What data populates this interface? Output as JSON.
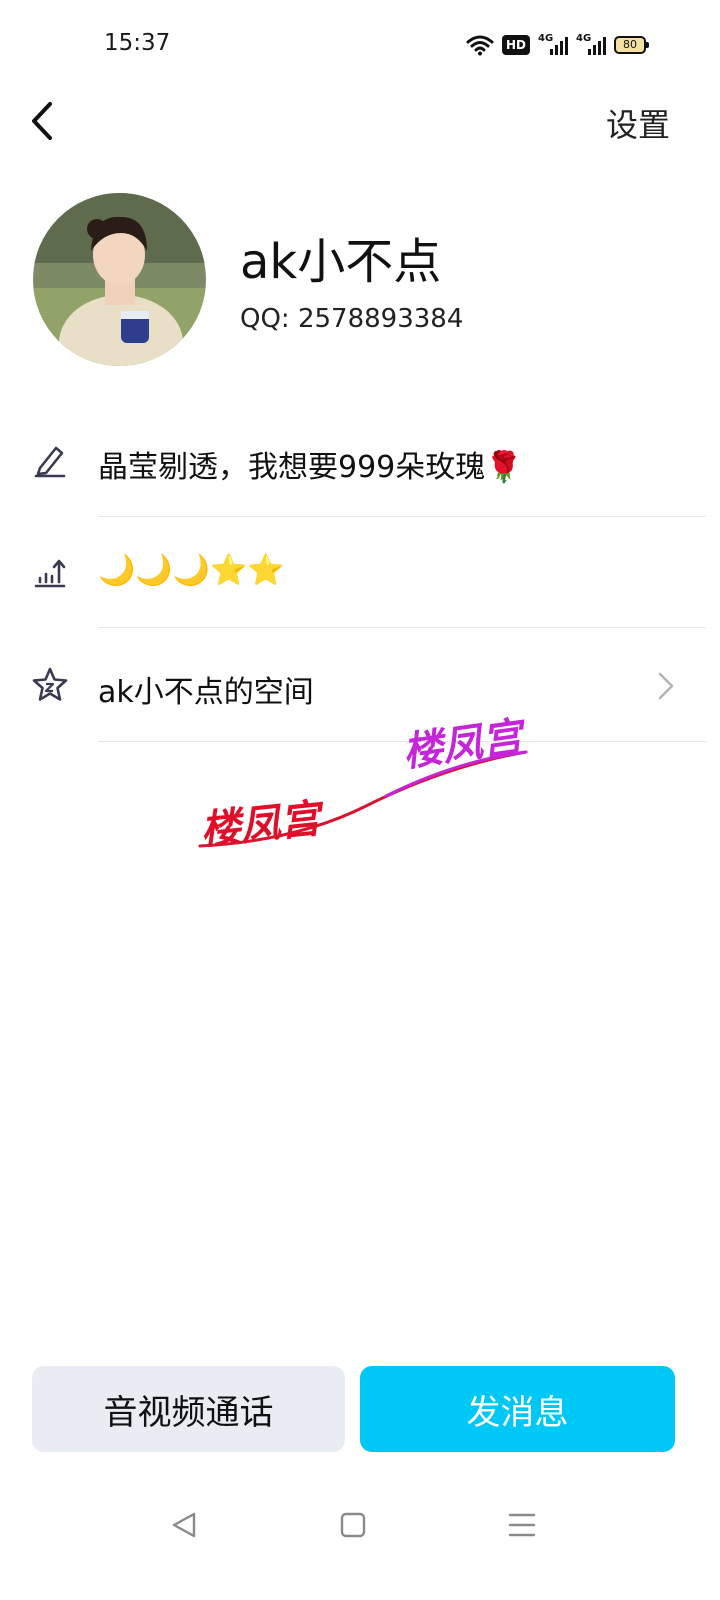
{
  "status_bar": {
    "time": "15:37",
    "hd_label": "HD",
    "network_1": "4G",
    "network_2": "4G",
    "battery": "80"
  },
  "nav": {
    "back_icon": "chevron-left-icon",
    "settings_label": "设置"
  },
  "profile": {
    "nickname": "ak小不点",
    "qq_label": "QQ: 2578893384",
    "avatar_icon": "avatar-photo"
  },
  "rows": [
    {
      "icon": "pencil-icon",
      "text": "晶莹剔透，我想要999朵玫瑰🌹"
    },
    {
      "icon": "level-chart-icon",
      "text": "🌙🌙🌙⭐⭐"
    },
    {
      "icon": "star-icon",
      "text": "ak小不点的空间",
      "chevron": "chevron-right-icon"
    }
  ],
  "watermark": {
    "text_1": "楼凤宫",
    "text_2": "楼凤宫",
    "color_1": "#e10e2a",
    "color_2": "#c425d8"
  },
  "actions": {
    "call_label": "音视频通话",
    "message_label": "发消息",
    "message_color": "#00c8f6"
  },
  "system_nav": {
    "back": "triangle-back-icon",
    "home": "square-home-icon",
    "menu": "menu-lines-icon"
  }
}
